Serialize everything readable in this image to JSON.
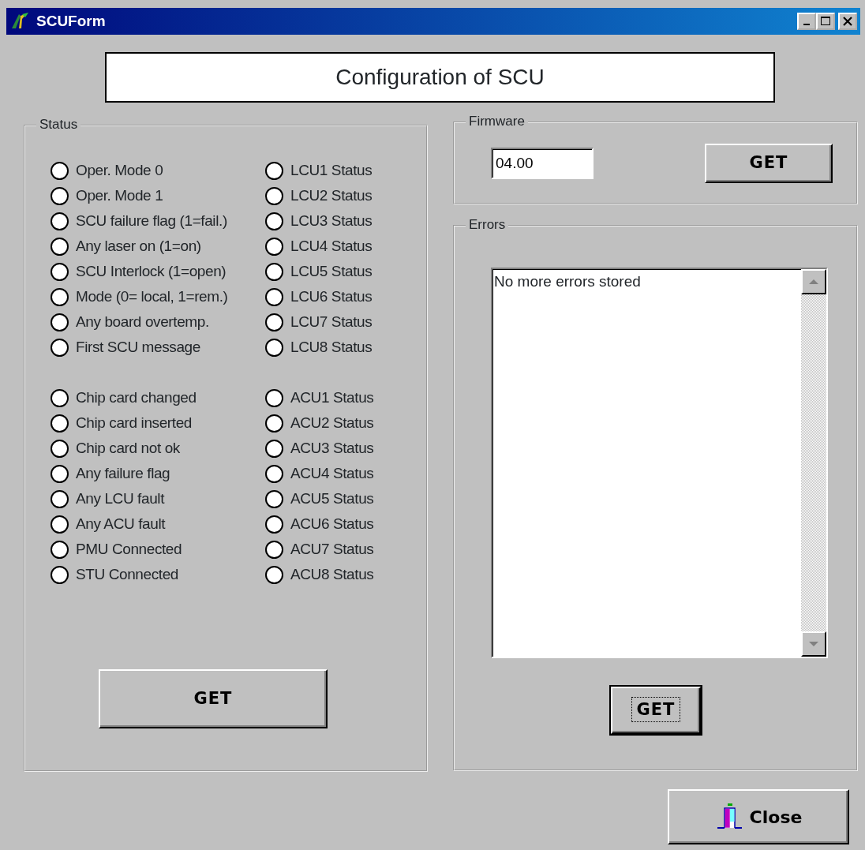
{
  "window": {
    "title": "SCUForm"
  },
  "header": "Configuration of SCU",
  "status": {
    "title": "Status",
    "groups": [
      {
        "left": [
          {
            "label": "Oper. Mode 0",
            "checked": false
          },
          {
            "label": "Oper. Mode 1",
            "checked": false
          },
          {
            "label": "SCU failure flag (1=fail.)",
            "checked": false
          },
          {
            "label": "Any laser on (1=on)",
            "checked": false
          },
          {
            "label": "SCU Interlock (1=open)",
            "checked": false
          },
          {
            "label": "Mode (0= local, 1=rem.)",
            "checked": false
          },
          {
            "label": "Any board overtemp.",
            "checked": false
          },
          {
            "label": "First SCU message",
            "checked": false
          }
        ],
        "right": [
          {
            "label": "LCU1 Status",
            "checked": false
          },
          {
            "label": "LCU2 Status",
            "checked": false
          },
          {
            "label": "LCU3 Status",
            "checked": false
          },
          {
            "label": "LCU4 Status",
            "checked": false
          },
          {
            "label": "LCU5 Status",
            "checked": false
          },
          {
            "label": "LCU6 Status",
            "checked": false
          },
          {
            "label": "LCU7 Status",
            "checked": false
          },
          {
            "label": "LCU8 Status",
            "checked": false
          }
        ]
      },
      {
        "left": [
          {
            "label": "Chip card changed",
            "checked": false
          },
          {
            "label": "Chip card inserted",
            "checked": false
          },
          {
            "label": "Chip card not ok",
            "checked": false
          },
          {
            "label": "Any failure flag",
            "checked": false
          },
          {
            "label": "Any LCU fault",
            "checked": false
          },
          {
            "label": "Any ACU fault",
            "checked": false
          },
          {
            "label": "PMU Connected",
            "checked": false
          },
          {
            "label": "STU Connected",
            "checked": false
          }
        ],
        "right": [
          {
            "label": "ACU1 Status",
            "checked": false
          },
          {
            "label": "ACU2 Status",
            "checked": false
          },
          {
            "label": "ACU3 Status",
            "checked": false
          },
          {
            "label": "ACU4 Status",
            "checked": false
          },
          {
            "label": "ACU5 Status",
            "checked": false
          },
          {
            "label": "ACU6 Status",
            "checked": false
          },
          {
            "label": "ACU7 Status",
            "checked": false
          },
          {
            "label": "ACU8 Status",
            "checked": false
          }
        ]
      }
    ],
    "button": {
      "label": "GET",
      "focused": false
    }
  },
  "firmware": {
    "title": "Firmware",
    "value": "04.00",
    "button": {
      "label": "GET",
      "focused": false
    }
  },
  "errors": {
    "title": "Errors",
    "items": [
      "No more errors stored"
    ],
    "button": {
      "label": "GET",
      "focused": true
    }
  },
  "close_button": {
    "label": "Close"
  }
}
